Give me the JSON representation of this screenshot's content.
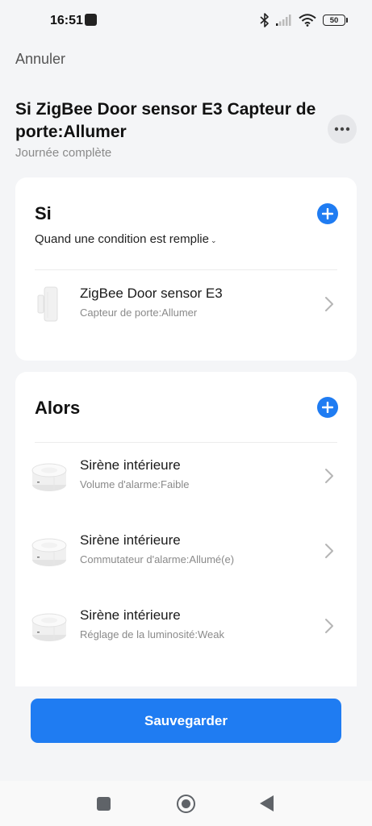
{
  "status_bar": {
    "time": "16:51",
    "battery": "50",
    "icons": [
      "bluetooth-icon",
      "signal-icon",
      "wifi-icon",
      "battery-icon"
    ]
  },
  "header": {
    "cancel_label": "Annuler",
    "title": "Si ZigBee Door sensor E3 Capteur de porte:Allumer",
    "subtitle": "Journée complète",
    "more_icon": "more-icon"
  },
  "if_section": {
    "heading": "Si",
    "condition_mode": "Quand une condition est remplie",
    "conditions": [
      {
        "device": "ZigBee Door sensor E3",
        "detail": "Capteur de porte:Allumer",
        "icon": "door-sensor-icon"
      }
    ]
  },
  "then_section": {
    "heading": "Alors",
    "actions": [
      {
        "device": "Sirène intérieure",
        "detail": "Volume d'alarme:Faible",
        "icon": "siren-icon"
      },
      {
        "device": "Sirène intérieure",
        "detail": "Commutateur d'alarme:Allumé(e)",
        "icon": "siren-icon"
      },
      {
        "device": "Sirène intérieure",
        "detail": "Réglage de la luminosité:Weak",
        "icon": "siren-icon"
      }
    ]
  },
  "save_label": "Sauvegarder",
  "colors": {
    "accent": "#1f7cf2",
    "background": "#f4f5f7",
    "card": "#ffffff"
  }
}
